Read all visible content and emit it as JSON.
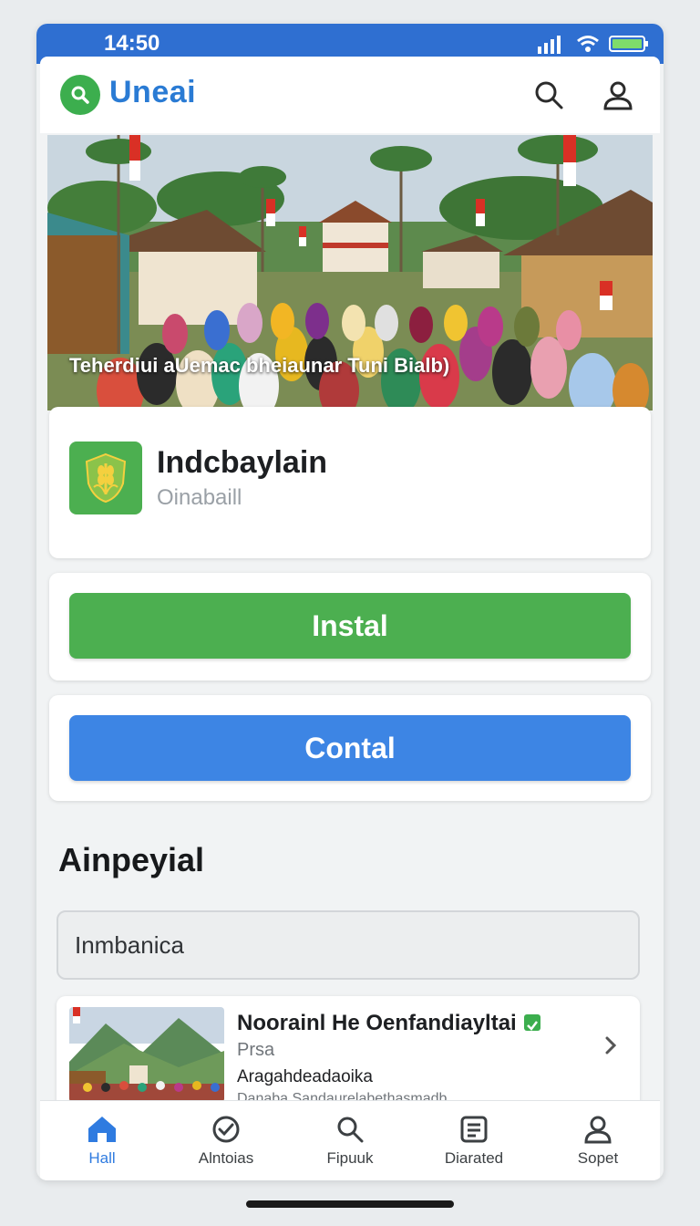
{
  "status_bar": {
    "time": "14:50"
  },
  "app_bar": {
    "title": "Uneai",
    "search_icon": "search-icon",
    "profile_icon": "user-icon"
  },
  "hero": {
    "caption": "Teherdiui aUemac bheiaunar Tuni Bialb)"
  },
  "app_info": {
    "name": "Indcbaylain",
    "subtitle": "Oinabaill"
  },
  "actions": {
    "install_label": "Instal",
    "contact_label": "Contal"
  },
  "section": {
    "title": "Ainpeyial"
  },
  "search": {
    "value": "Inmbanica"
  },
  "list_item": {
    "title": "Noorainl He Oenfandiayltai",
    "subtitle": "Prsa",
    "description": "Aragahdeadaoika",
    "extra": "Danaba Sandaurelabethasmadb"
  },
  "bottom_nav": [
    {
      "label": "Hall",
      "icon": "home-icon",
      "active": true
    },
    {
      "label": "Alntoias",
      "icon": "check-circle-icon",
      "active": false
    },
    {
      "label": "Fipuuk",
      "icon": "search-icon",
      "active": false
    },
    {
      "label": "Diarated",
      "icon": "document-icon",
      "active": false
    },
    {
      "label": "Sopet",
      "icon": "user-icon",
      "active": false
    }
  ],
  "colors": {
    "primary_blue": "#2f6fd1",
    "accent_green": "#4caf50",
    "contact_blue": "#3d85e4"
  }
}
